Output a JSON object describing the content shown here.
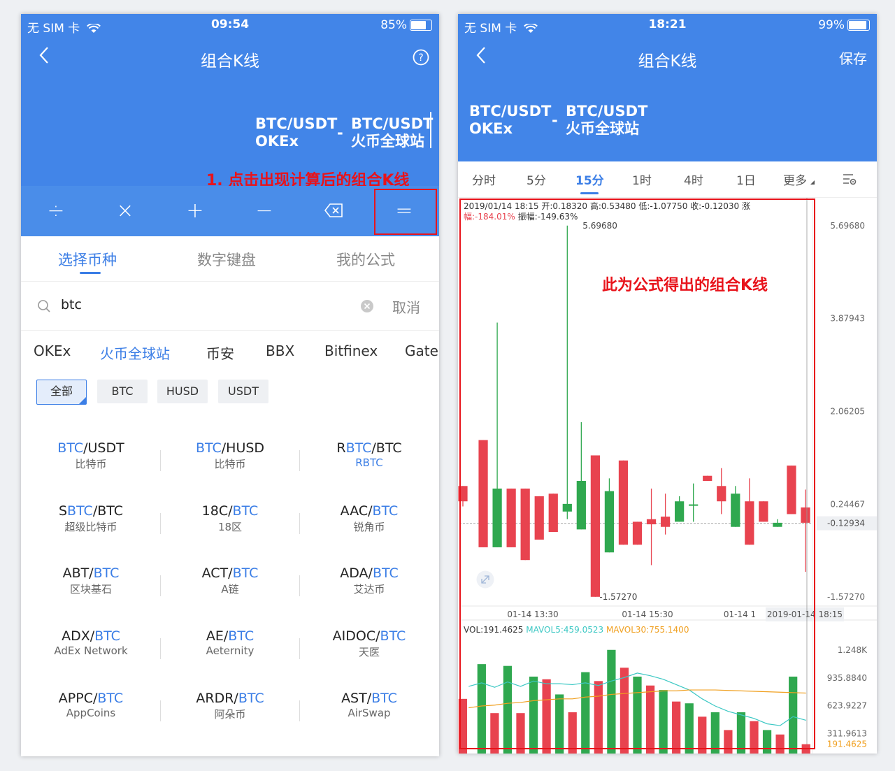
{
  "left": {
    "status": {
      "carrier": "无 SIM 卡",
      "time": "09:54",
      "battery": "85%",
      "battery_level": 0.85
    },
    "nav": {
      "title": "组合K线"
    },
    "formula": {
      "left_pair": "BTC/USDT",
      "left_exchange": "OKEx",
      "operator": "-",
      "right_pair": "BTC/USDT",
      "right_exchange": "火币全球站"
    },
    "annotation": "1. 点击出现计算后的组合K线",
    "operators": [
      "÷",
      "×",
      "+",
      "−",
      "⌫",
      "="
    ],
    "tabs": [
      "选择币种",
      "数字键盘",
      "我的公式"
    ],
    "search": {
      "value": "btc",
      "cancel": "取消"
    },
    "exchanges": [
      "OKEx",
      "火币全球站",
      "币安",
      "BBX",
      "Bitfinex",
      "Gate"
    ],
    "filters": [
      "全部",
      "BTC",
      "HUSD",
      "USDT"
    ],
    "pairs": [
      {
        "pre": "",
        "hl": "BTC",
        "post": "/USDT",
        "sub": "比特币",
        "sub_blue": false
      },
      {
        "pre": "",
        "hl": "BTC",
        "post": "/HUSD",
        "sub": "比特币",
        "sub_blue": false
      },
      {
        "pre": "R",
        "hl": "BTC",
        "post": "/BTC",
        "sub": "RBTC",
        "sub_blue": true
      },
      {
        "pre": "S",
        "hl": "BTC",
        "post": "/BTC",
        "sub": "超级比特币",
        "sub_blue": false
      },
      {
        "pre": "18C/",
        "hl": "BTC",
        "post": "",
        "sub": "18区",
        "sub_blue": false
      },
      {
        "pre": "AAC/",
        "hl": "BTC",
        "post": "",
        "sub": "锐角币",
        "sub_blue": false
      },
      {
        "pre": "ABT/",
        "hl": "BTC",
        "post": "",
        "sub": "区块基石",
        "sub_blue": false
      },
      {
        "pre": "ACT/",
        "hl": "BTC",
        "post": "",
        "sub": "A链",
        "sub_blue": false
      },
      {
        "pre": "ADA/",
        "hl": "BTC",
        "post": "",
        "sub": "艾达币",
        "sub_blue": false
      },
      {
        "pre": "ADX/",
        "hl": "BTC",
        "post": "",
        "sub": "AdEx Network",
        "sub_blue": false
      },
      {
        "pre": "AE/",
        "hl": "BTC",
        "post": "",
        "sub": "Aeternity",
        "sub_blue": false
      },
      {
        "pre": "AIDOC/",
        "hl": "BTC",
        "post": "",
        "sub": "天医",
        "sub_blue": false
      },
      {
        "pre": "APPC/",
        "hl": "BTC",
        "post": "",
        "sub": "AppCoins",
        "sub_blue": false
      },
      {
        "pre": "ARDR/",
        "hl": "BTC",
        "post": "",
        "sub": "阿朵币",
        "sub_blue": false
      },
      {
        "pre": "AST/",
        "hl": "BTC",
        "post": "",
        "sub": "AirSwap",
        "sub_blue": false
      }
    ]
  },
  "right": {
    "status": {
      "carrier": "无 SIM 卡",
      "time": "18:21",
      "battery": "99%",
      "battery_level": 0.99
    },
    "nav": {
      "title": "组合K线",
      "save": "保存"
    },
    "formula": {
      "left_pair": "BTC/USDT",
      "left_exchange": "OKEx",
      "operator": "-",
      "right_pair": "BTC/USDT",
      "right_exchange": "火币全球站"
    },
    "periods": [
      "分时",
      "5分",
      "15分",
      "1时",
      "4时",
      "1日",
      "更多"
    ],
    "active_period": "15分",
    "info_line1": "2019/01/14 18:15 开:0.18320 高:0.53480 低:-1.07750 收:-0.12030 涨",
    "info_prefix": "幅:",
    "info_change": "-184.01%",
    "info_amplitude": "振幅:-149.63%",
    "annotation": "此为公式得出的组合K线",
    "vol_line": {
      "vol": "VOL:191.4625",
      "ma5": "MAVOL5:459.0523",
      "ma30": "MAVOL30:755.1400"
    },
    "colors": {
      "up": "#2fa84f",
      "down": "#e8434f",
      "ma5": "#3cc8c4",
      "ma30": "#f0a020",
      "accent": "#3b7ee6"
    }
  },
  "chart_data": [
    {
      "type": "candlestick",
      "title": "",
      "y_ticks": [
        "5.69680",
        "3.87943",
        "2.06205",
        "0.24467",
        "-1.57270"
      ],
      "ylim": [
        -1.5727,
        5.6968
      ],
      "current_price": "-0.12934",
      "max_label": "5.69680",
      "min_label": "-1.57270",
      "x_ticks": [
        "01-14 13:30",
        "01-14 15:30",
        "01-14 1"
      ],
      "crosshair_label": "2019-01-14 18:15",
      "candles": [
        {
          "o": 0.6,
          "c": 0.3,
          "h": 0.6,
          "l": 0.2
        },
        {
          "o": 1.5,
          "c": -0.6,
          "h": 1.5,
          "l": -0.6
        },
        {
          "o": -0.6,
          "c": 0.55,
          "h": 3.8,
          "l": -0.6
        },
        {
          "o": 0.55,
          "c": -0.6,
          "h": 0.55,
          "l": -0.6
        },
        {
          "o": 0.55,
          "c": -0.85,
          "h": 0.55,
          "l": -0.85
        },
        {
          "o": 0.4,
          "c": -0.45,
          "h": 0.4,
          "l": -0.45
        },
        {
          "o": 0.45,
          "c": -0.3,
          "h": 0.45,
          "l": -0.3
        },
        {
          "o": 0.1,
          "c": 0.25,
          "h": 5.7,
          "l": -0.05
        },
        {
          "o": -0.25,
          "c": 0.7,
          "h": 1.85,
          "l": -0.25
        },
        {
          "o": 1.2,
          "c": -1.57,
          "h": 1.2,
          "l": -1.57
        },
        {
          "o": -0.7,
          "c": 0.5,
          "h": 0.75,
          "l": -0.7
        },
        {
          "o": 1.1,
          "c": -0.55,
          "h": 1.1,
          "l": -0.55
        },
        {
          "o": -0.1,
          "c": -0.55,
          "h": -0.1,
          "l": -0.55
        },
        {
          "o": -0.05,
          "c": -0.15,
          "h": 0.55,
          "l": -0.95
        },
        {
          "o": 0.0,
          "c": -0.2,
          "h": 0.45,
          "l": -0.35
        },
        {
          "o": -0.1,
          "c": 0.3,
          "h": 0.4,
          "l": -0.1
        },
        {
          "o": 0.24,
          "c": 0.24,
          "h": 0.65,
          "l": -0.1
        },
        {
          "o": 0.8,
          "c": 0.7,
          "h": 0.8,
          "l": 0.7
        },
        {
          "o": 0.6,
          "c": 0.3,
          "h": 0.95,
          "l": 0.05
        },
        {
          "o": -0.2,
          "c": 0.45,
          "h": 0.6,
          "l": -0.2
        },
        {
          "o": 0.3,
          "c": -0.55,
          "h": 0.75,
          "l": -0.55
        },
        {
          "o": 0.3,
          "c": -0.1,
          "h": 0.3,
          "l": -0.1
        },
        {
          "o": -0.2,
          "c": -0.12,
          "h": -0.05,
          "l": -0.2
        },
        {
          "o": 1.0,
          "c": 0.05,
          "h": 1.0,
          "l": 0.05
        },
        {
          "o": 0.18,
          "c": -0.12,
          "h": 0.53,
          "l": -1.08
        }
      ]
    },
    {
      "type": "bar",
      "title": "",
      "y_ticks": [
        "1.248K",
        "935.8840",
        "623.9227",
        "311.9613",
        "0"
      ],
      "ylim": [
        0,
        1248
      ],
      "last_value_label": "191.4625",
      "values": [
        700,
        1090,
        540,
        1070,
        540,
        950,
        920,
        750,
        550,
        1000,
        900,
        1250,
        1050,
        950,
        850,
        800,
        670,
        650,
        500,
        550,
        350,
        550,
        450,
        350,
        300,
        950,
        191
      ],
      "ma5": [
        840,
        880,
        830,
        890,
        840,
        900,
        870,
        870,
        860,
        880,
        850,
        900,
        940,
        990,
        960,
        920,
        860,
        800,
        700,
        620,
        560,
        520,
        480,
        420,
        400,
        500,
        460
      ],
      "ma30": [
        600,
        620,
        630,
        650,
        660,
        680,
        690,
        700,
        700,
        720,
        730,
        750,
        760,
        770,
        780,
        790,
        790,
        800,
        800,
        800,
        795,
        790,
        785,
        780,
        775,
        770,
        765
      ]
    }
  ]
}
